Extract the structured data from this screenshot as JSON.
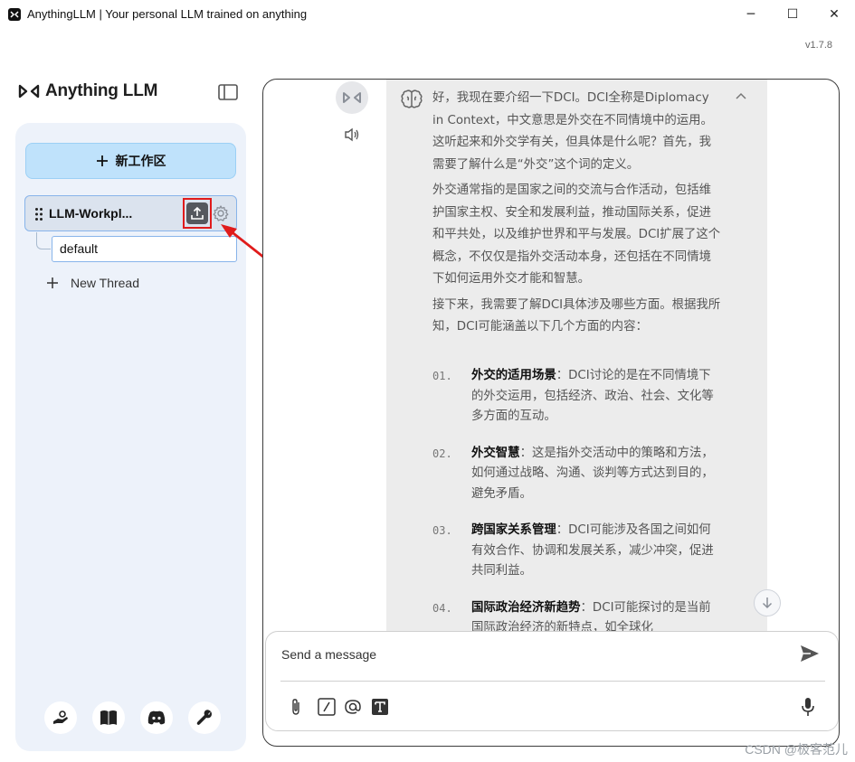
{
  "window": {
    "title": "AnythingLLM | Your personal LLM trained on anything",
    "version": "v1.7.8",
    "minimize": "─",
    "maximize": "☐",
    "close": "✕"
  },
  "sidebar": {
    "brand": "Anything LLM",
    "new_workspace_label": "新工作区",
    "workspace": {
      "name": "LLM-Workpl..."
    },
    "threads": [
      {
        "name": "default"
      }
    ],
    "new_thread_label": "New Thread",
    "footer_icons": [
      "community-hub-icon",
      "docs-book-icon",
      "discord-icon",
      "settings-wrench-icon"
    ]
  },
  "chat": {
    "paragraphs": [
      "好，我现在要介绍一下DCI。DCI全称是Diplomacy in Context，中文意思是外交在不同情境中的运用。这听起来和外交学有关，但具体是什么呢？首先，我需要了解什么是“外交”这个词的定义。",
      "外交通常指的是国家之间的交流与合作活动，包括维护国家主权、安全和发展利益，推动国际关系，促进和平共处，以及维护世界和平与发展。DCI扩展了这个概念，不仅仅是指外交活动本身，还包括在不同情境下如何运用外交才能和智慧。",
      "接下来，我需要了解DCI具体涉及哪些方面。根据我所知，DCI可能涵盖以下几个方面的内容："
    ],
    "list": [
      {
        "num": "01.",
        "title": "外交的适用场景",
        "text": "：DCI讨论的是在不同情境下的外交运用，包括经济、政治、社会、文化等多方面的互动。"
      },
      {
        "num": "02.",
        "title": "外交智慧",
        "text": "：这是指外交活动中的策略和方法，如何通过战略、沟通、谈判等方式达到目的，避免矛盾。"
      },
      {
        "num": "03.",
        "title": "跨国家关系管理",
        "text": "：DCI可能涉及各国之间如何有效合作、协调和发展关系，减少冲突，促进共同利益。"
      },
      {
        "num": "04.",
        "title": "国际政治经济新趋势",
        "text": "：DCI可能探讨的是当前国际政治经济的新特点，如全球化"
      }
    ],
    "composer": {
      "placeholder": "Send a message"
    }
  },
  "watermark": "CSDN @极客范儿"
}
